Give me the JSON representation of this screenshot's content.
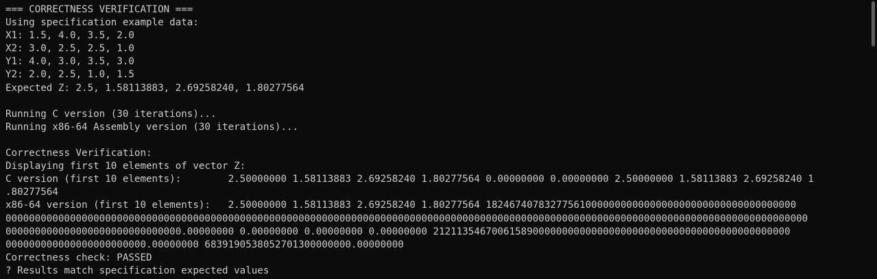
{
  "terminal": {
    "lines": [
      "=== CORRECTNESS VERIFICATION ===",
      "Using specification example data:",
      "X1: 1.5, 4.0, 3.5, 2.0",
      "X2: 3.0, 2.5, 2.5, 1.0",
      "Y1: 4.0, 3.0, 3.5, 3.0",
      "Y2: 2.0, 2.5, 1.0, 1.5",
      "Expected Z: 2.5, 1.58113883, 2.69258240, 1.80277564",
      "",
      "Running C version (30 iterations)...",
      "Running x86-64 Assembly version (30 iterations)...",
      "",
      "Correctness Verification:",
      "Displaying first 10 elements of vector Z:",
      "C version (first 10 elements):        2.50000000 1.58113883 2.69258240 1.80277564 0.00000000 0.00000000 2.50000000 1.58113883 2.69258240 1",
      ".80277564",
      "x86-64 version (first 10 elements):   2.50000000 1.58113883 2.69258240 1.80277564 18246740783277561000000000000000000000000000000000000",
      "00000000000000000000000000000000000000000000000000000000000000000000000000000000000000000000000000000000000000000000000000000000000000000",
      "000000000000000000000000000000.00000000 0.00000000 0.00000000 0.00000000 2121135467006158900000000000000000000000000000000000000000000",
      "000000000000000000000000.00000000 6839190538052701300000000.00000000",
      "Correctness check: PASSED",
      "? Results match specification expected values"
    ]
  },
  "colors": {
    "background": "#0c0c0c",
    "text": "#cccccc",
    "scroll_thumb": "#5f5f5f"
  }
}
